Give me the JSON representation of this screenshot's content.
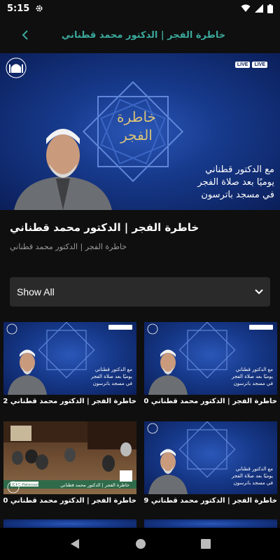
{
  "status": {
    "time": "5:15"
  },
  "app_bar": {
    "title": "خاطرة الفجر | الدكتور محمد قطناني"
  },
  "hero": {
    "live_chips": [
      "LIVE",
      "LIVE"
    ],
    "calligraphy": [
      "خاطرة",
      "الفجر"
    ],
    "lines": [
      "مع الدكتور قطناني",
      "يوميًا بعد صلاة الفجر",
      "في مسجد باترسون"
    ]
  },
  "details": {
    "title": "خاطرة الفجر | الدكتور محمد قطناني",
    "subtitle": "خاطرة الفجر | الدكتور محمد قطناني"
  },
  "filter": {
    "selected": "Show All"
  },
  "videos": [
    {
      "caption": "خاطرة الفجر | الدكتور محمد  قطناني 1/22/...",
      "style": "promo",
      "overlay": [
        "مع الدكتور قطناني",
        "يوميًا بعد صلاة الفجر",
        "في مسجد باترسون"
      ]
    },
    {
      "caption": "خاطرة الفجر | الدكتور محمد  قطناني 1/20/...",
      "style": "promo",
      "overlay": [
        "مع الدكتور قطناني",
        "يوميًا بعد صلاة الفجر",
        "في مسجد باترسون"
      ]
    },
    {
      "caption": "خاطرة الفجر | الدكتور محمد  قطناني 1/20/...",
      "style": "live",
      "overlay": [
        "ICPC-Paterson",
        "خاطرة الفجر | الدكتور محمد قطناني"
      ]
    },
    {
      "caption": "خاطرة الفجر | الدكتور محمد  قطناني 1/19/...",
      "style": "promo",
      "overlay": [
        "مع الدكتور قطناني",
        "يوميًا بعد صلاة الفجر",
        "في مسجد باترسون"
      ]
    }
  ],
  "colors": {
    "accent": "#3ba99c",
    "background": "#0f0f0f",
    "dropdown": "#2a2a2a"
  }
}
